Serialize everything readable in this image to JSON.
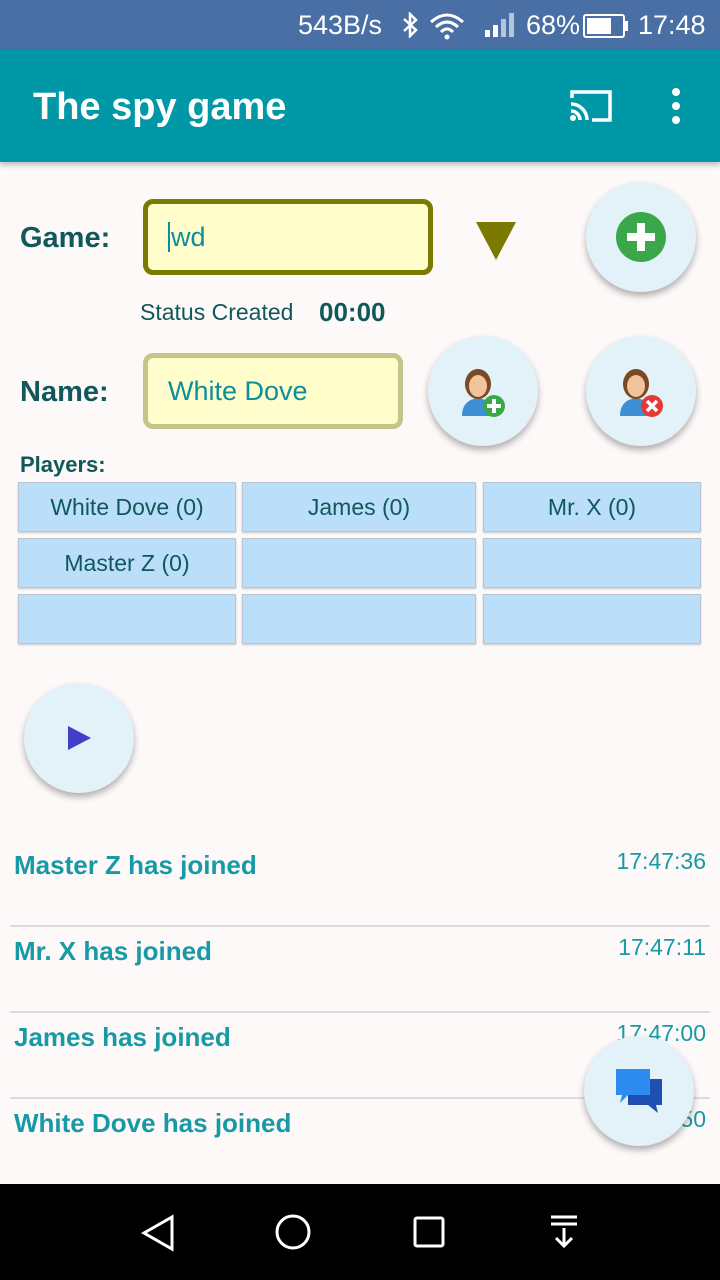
{
  "status_bar": {
    "network_speed": "543B/s",
    "battery": "68%",
    "time": "17:48"
  },
  "app_bar": {
    "title": "The spy game"
  },
  "game": {
    "label": "Game:",
    "value": "wd",
    "status_text": "Status Created",
    "timer": "00:00"
  },
  "name": {
    "label": "Name:",
    "value": "White Dove"
  },
  "players": {
    "label": "Players:",
    "rows": [
      [
        "White Dove (0)",
        "James (0)",
        "Mr. X (0)"
      ],
      [
        "Master Z (0)",
        "",
        ""
      ],
      [
        "",
        "",
        ""
      ]
    ]
  },
  "messages": [
    {
      "text": "Master Z has joined",
      "time": "17:47:36"
    },
    {
      "text": "Mr. X has joined",
      "time": "17:47:11"
    },
    {
      "text": "James has joined",
      "time": "17:47:00"
    },
    {
      "text": "White Dove has joined",
      "time": "17:46:50"
    }
  ],
  "colors": {
    "app_bar": "#0097a7",
    "accent_text": "#1799a6",
    "label_text": "#10585a",
    "input_background": "#fffdcc",
    "cell_background": "#bbdefb"
  },
  "icons": {
    "add_game": "plus-circle-icon",
    "add_player": "person-add-icon",
    "remove_player": "person-remove-icon",
    "start": "play-icon",
    "chat": "chat-icon",
    "cast": "cast-icon",
    "more": "more-vert-icon"
  }
}
